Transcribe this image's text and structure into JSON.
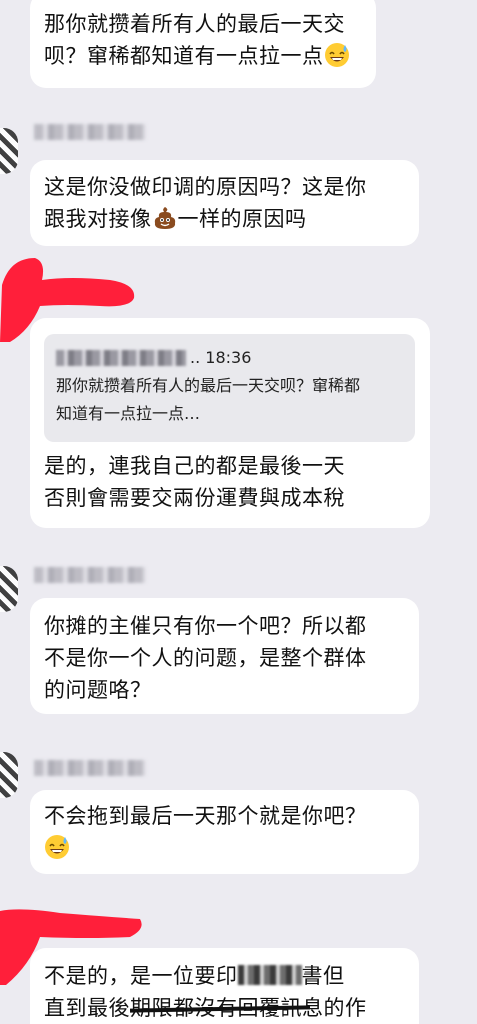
{
  "messages": {
    "m1": {
      "lines": [
        "那你就攒着所有人的最后一天交",
        "呗？窜稀都知道有一点拉一点"
      ],
      "emoji": "grinning-sweat-emoji"
    },
    "m2": {
      "lines": [
        "这是你没做印调的原因吗？这是你",
        "跟我对接像",
        "一样的原因吗"
      ],
      "emoji": "poop-emoji"
    },
    "m3": {
      "quote": {
        "time": ".. 18:36",
        "lines": [
          "那你就攒着所有人的最后一天交呗？窜稀都",
          "知道有一点拉一点…"
        ]
      },
      "lines": [
        "是的，連我自己的都是最後一天",
        "否則會需要交兩份運費與成本稅"
      ]
    },
    "m4": {
      "lines": [
        "你摊的主催只有你一个吧？所以都",
        "不是你一个人的问题，是整个群体",
        "的问题咯？"
      ]
    },
    "m5": {
      "lines": [
        "不会拖到最后一天那个就是你吧？"
      ],
      "emoji": "grinning-sweat-emoji"
    },
    "m6": {
      "lines": [
        "不是的，是一位要印",
        "書但",
        "直到最後期限都沒有回覆訊息的作"
      ]
    }
  },
  "colors": {
    "background": "#ecebf1",
    "bubble": "#ffffff",
    "quote": "#e9e9ed",
    "annotation": "#ff1f3a"
  }
}
